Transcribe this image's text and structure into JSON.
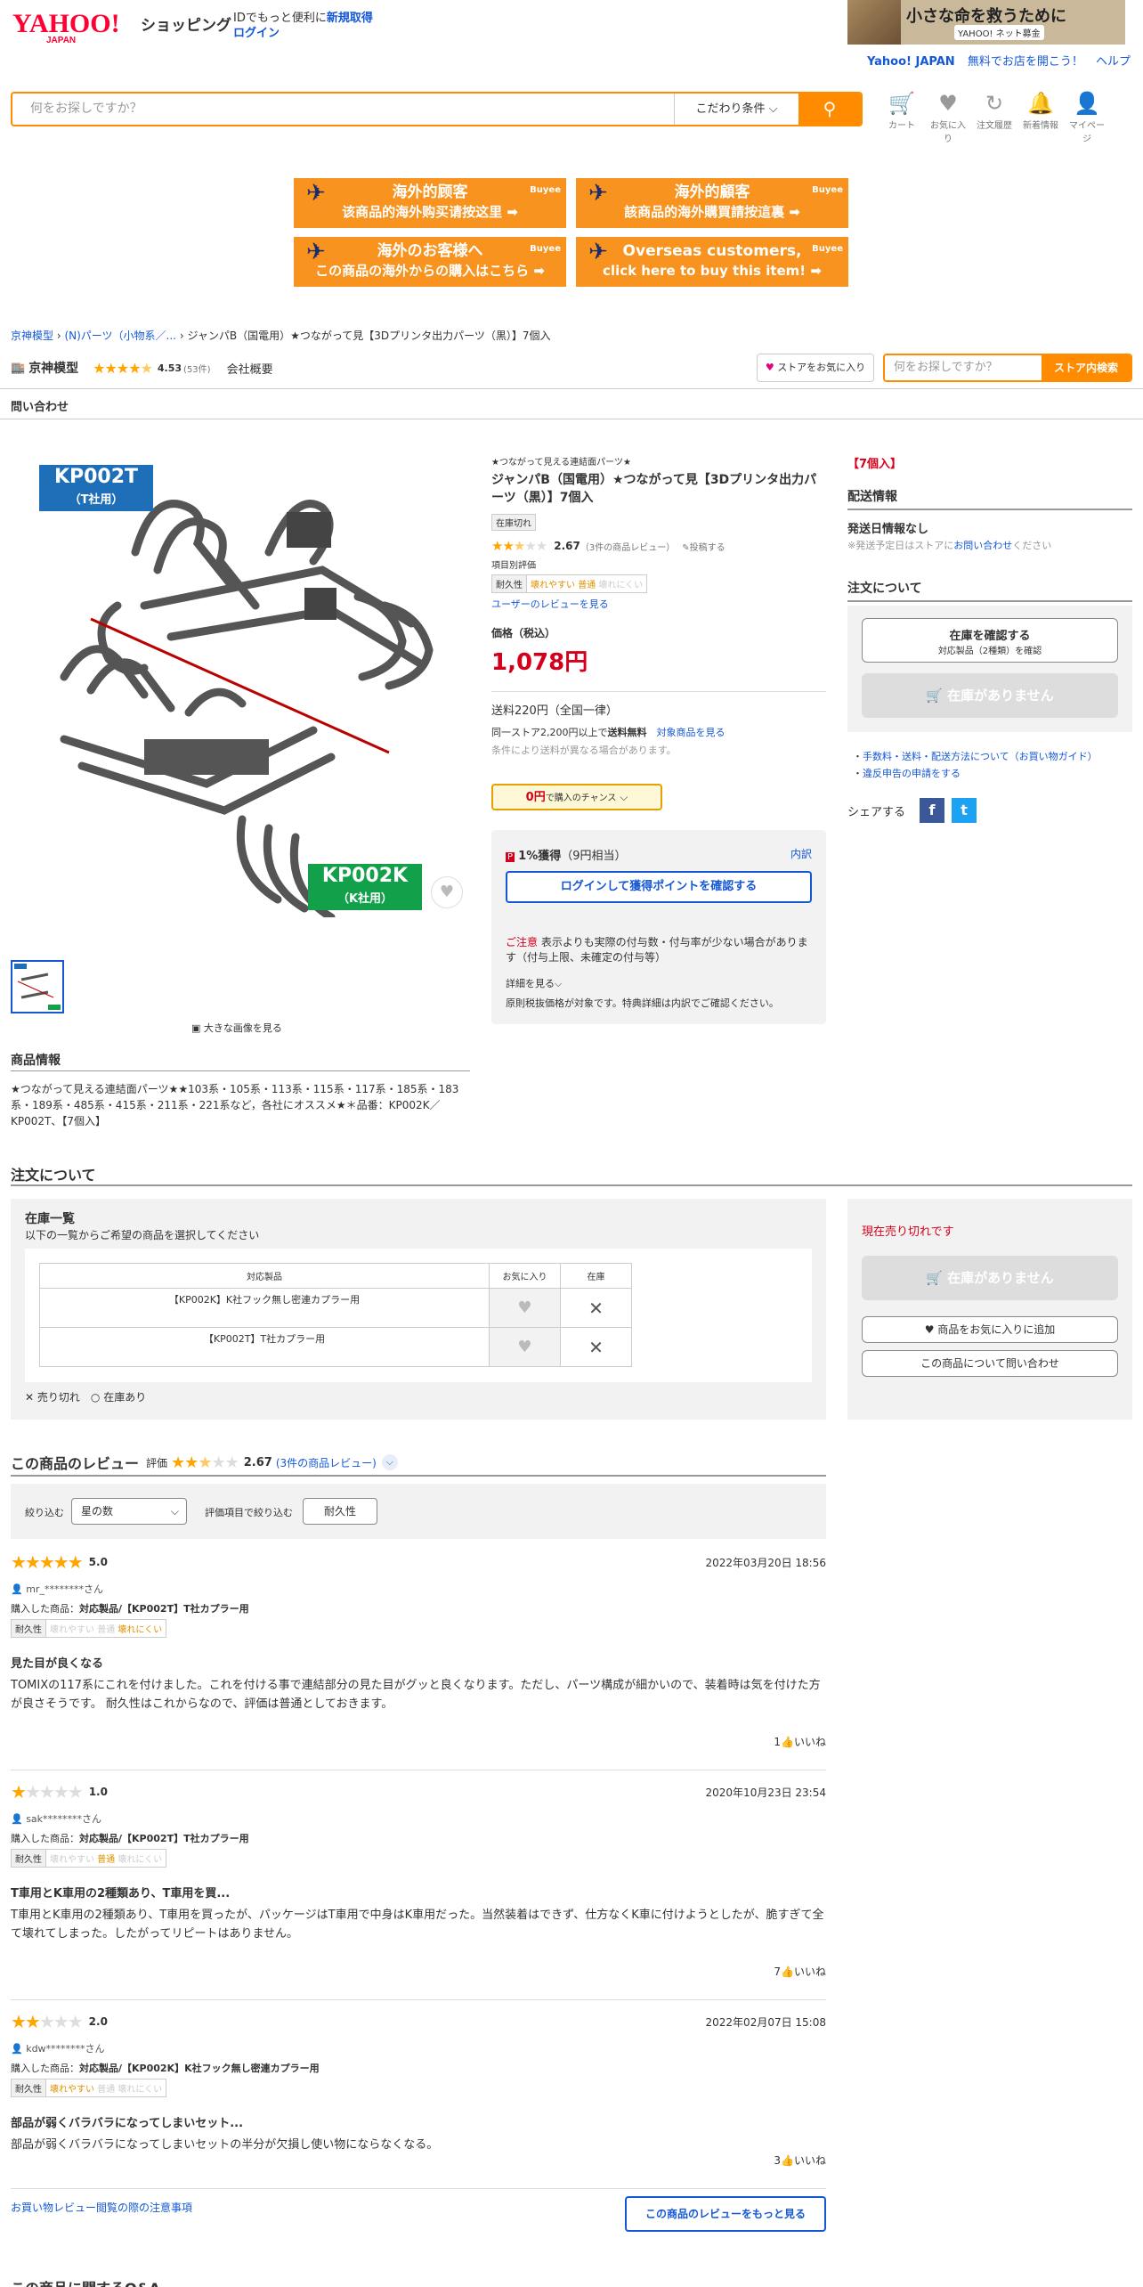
{
  "header": {
    "brand": "YAHOO! JAPAN",
    "service": "ショッピング",
    "id_text": "IDでもっと便利に",
    "signup": "新規取得",
    "login": "ログイン",
    "ad_title": "小さな命を救うために",
    "ad_sub": "YAHOO! ネット募金",
    "links": [
      "Yahoo! JAPAN",
      "無料でお店を開こう！",
      "ヘルプ"
    ],
    "search_placeholder": "何をお探しですか？",
    "condition": "こだわり条件",
    "icons": [
      {
        "icon": "cart-icon",
        "label": "カート"
      },
      {
        "icon": "heart-icon",
        "label": "お気に入り"
      },
      {
        "icon": "history-icon",
        "label": "注文履歴"
      },
      {
        "icon": "bell-icon",
        "label": "新着情報"
      },
      {
        "icon": "user-icon",
        "label": "マイページ"
      }
    ]
  },
  "buyee": [
    {
      "line1": "海外的顾客",
      "line2": "该商品的海外购买请按这里 ➡",
      "brand": "Buyee"
    },
    {
      "line1": "海外的顧客",
      "line2": "該商品的海外購買請按這裏 ➡",
      "brand": "Buyee"
    },
    {
      "line1": "海外のお客様へ",
      "line2": "この商品の海外からの購入はこちら ➡",
      "brand": "Buyee"
    },
    {
      "line1": "Overseas customers,",
      "line2": "click here to buy this item! ➡",
      "brand": "Buyee"
    }
  ],
  "breadcrumb": [
    "京神模型",
    "(N)パーツ（小物系／...",
    "ジャンパB（国電用）★つながって見【3Dプリンタ出力パーツ（黒）】7個入"
  ],
  "store": {
    "name": "京神模型",
    "rating": "4.53",
    "count": "(53件)",
    "about": "会社概要",
    "fav_label": "ストアをお気に入り",
    "search_placeholder": "何をお探しですか？",
    "search_btn": "ストア内検索",
    "inquiry": "問い合わせ"
  },
  "image": {
    "tag_t": "KP002T",
    "tag_t_sub": "（T社用）",
    "tag_k": "KP002K",
    "tag_k_sub": "（K社用）",
    "view_large": "大きな画像を見る"
  },
  "product_info": {
    "heading": "商品情報",
    "text": "★つながって見える連結面パーツ★★103系・105系・113系・115系・117系・185系・183系・189系・485系・415系・211系・221系など，各社にオススメ★＊品番：KP002K／KP002T、【7個入】"
  },
  "product": {
    "catch": "★つながって見える連結面パーツ★",
    "title": "ジャンパB（国電用）★つながって見【3Dプリンタ出力パーツ（黒）】7個入",
    "stock_badge": "在庫切れ",
    "rating": "2.67",
    "rating_count": "（3件の商品レビュー）",
    "post_review": "投稿する",
    "item_eval": "項目別評価",
    "durability": "耐久性",
    "dur_scale": [
      "壊れやすい",
      "普通",
      "壊れにくい"
    ],
    "user_reviews": "ユーザーのレビューを見る",
    "price_label": "価格（税込）",
    "price": "1,078円",
    "shipping": "送料220円（全国一律）",
    "free_ship_pre": "同一ストア2,200円以上で",
    "free_ship": "送料無料",
    "free_ship_link": "対象商品を見る",
    "ship_note": "条件により送料が異なる場合があります。",
    "chance_amount": "0円",
    "chance_text": "で購入のチャンス",
    "points": "1%獲得",
    "points_sub": "（9円相当）",
    "points_detail": "内訳",
    "login_btn": "ログインして獲得ポイントを確認する",
    "caution_label": "ご注意",
    "caution": "表示よりも実際の付与数・付与率が少ない場合があります（付与上限、未確定の付与等）",
    "more": "詳細を見る",
    "tax_note": "原則税抜価格が対象です。特典詳細は内訳でご確認ください。"
  },
  "right": {
    "qty": "【7個入】",
    "delivery_h": "配送情報",
    "delivery_none": "発送日情報なし",
    "delivery_note_pre": "※発送予定日はストアに",
    "delivery_note_link": "お問い合わせ",
    "delivery_note_post": "ください",
    "order_h": "注文について",
    "check_stock": "在庫を確認する",
    "check_stock_sub": "対応製品（2種類）を確認",
    "no_stock": "在庫がありません",
    "link1": "手数料・送料・配送方法について（お買い物ガイド）",
    "link2": "違反申告の申請をする",
    "share": "シェアする"
  },
  "order": {
    "heading": "注文について",
    "stock_list": "在庫一覧",
    "stock_sub": "以下の一覧からご希望の商品を選択してください",
    "columns": [
      "対応製品",
      "お気に入り",
      "在庫"
    ],
    "rows": [
      "【KP002K】K社フック無し密連カプラー用",
      "【KP002T】T社カプラー用"
    ],
    "legend_sold": "売り切れ",
    "legend_avail": "在庫あり",
    "sold_out": "現在売り切れです",
    "no_stock": "在庫がありません",
    "add_fav": "商品をお気に入りに追加",
    "ask": "この商品について問い合わせ"
  },
  "reviews": {
    "heading": "この商品のレビュー",
    "eval": "評価",
    "rating": "2.67",
    "count": "(3件の商品レビュー)",
    "filter_label": "絞り込む",
    "filter_value": "星の数",
    "item_filter": "評価項目で絞り込む",
    "item_btn": "耐久性",
    "purchased": "購入した商品：",
    "like": "いいね",
    "items": [
      {
        "score": "5.0",
        "stars": 5,
        "date": "2022年03月20日 18:56",
        "user": "mr_********さん",
        "product": "対応製品/【KP002T】T社カプラー用",
        "dur": 2,
        "title": "見た目が良くなる",
        "body": "TOMIXの117系にこれを付けました。これを付ける事で連結部分の見た目がグッと良くなります。ただし、パーツ構成が細かいので、装着時は気を付けた方が良さそうです。 耐久性はこれからなので、評価は普通としておきます。",
        "likes": "1"
      },
      {
        "score": "1.0",
        "stars": 1,
        "date": "2020年10月23日 23:54",
        "user": "sak********さん",
        "product": "対応製品/【KP002T】T社カプラー用",
        "dur": 1,
        "title": "T車用とK車用の2種類あり、T車用を買...",
        "body": "T車用とK車用の2種類あり、T車用を買ったが、パッケージはT車用で中身はK車用だった。当然装着はできず、仕方なくK車に付けようとしたが、脆すぎて全て壊れてしまった。したがってリピートはありません。",
        "likes": "7"
      },
      {
        "score": "2.0",
        "stars": 2,
        "date": "2022年02月07日 15:08",
        "user": "kdw********さん",
        "product": "対応製品/【KP002K】K社フック無し密連カプラー用",
        "dur": 0,
        "title": "部品が弱くバラバラになってしまいセット...",
        "body": "部品が弱くバラバラになってしまいセットの半分が欠損し使い物にならなくなる。",
        "likes": "3"
      }
    ],
    "guide_link": "お買い物レビュー閲覧の際の注意事項",
    "more_btn": "この商品のレビューをもっと見る"
  },
  "bottom_heading": "この商品に関するQ&A"
}
